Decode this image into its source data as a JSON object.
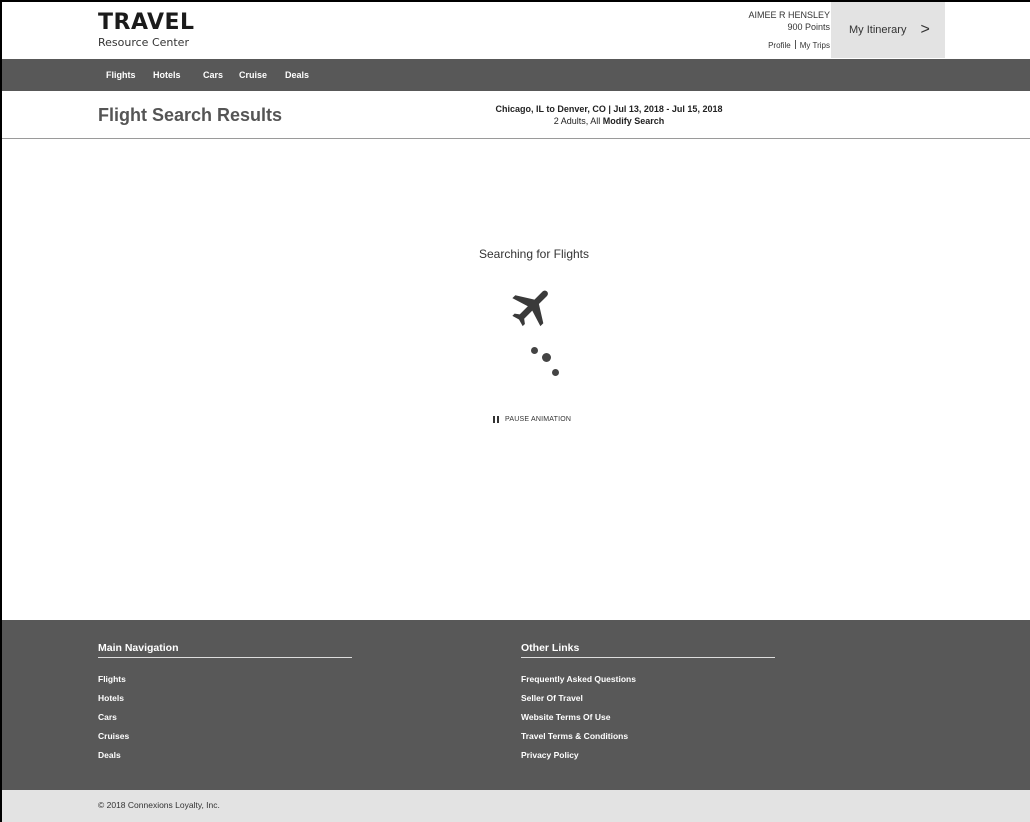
{
  "brand": {
    "name": "TRAVEL",
    "tagline": "Resource Center"
  },
  "user": {
    "name": "AIMEE R HENSLEY",
    "points": "900 Points",
    "profile_label": "Profile",
    "trips_label": "My Trips"
  },
  "itinerary": {
    "label": "My Itinerary",
    "chevron": ">"
  },
  "nav": {
    "items": [
      "Flights",
      "Hotels",
      "Cars",
      "Cruise",
      "Deals"
    ]
  },
  "page": {
    "title": "Flight Search Results",
    "route": "Chicago, IL to Denver, CO | Jul 13, 2018 - Jul 15, 2018",
    "travelers": "2 Adults, All",
    "modify_label": "Modify Search"
  },
  "loading": {
    "message": "Searching for Flights",
    "pause_label": "PAUSE ANIMATION",
    "icon": "airplane-icon"
  },
  "footer": {
    "main_nav": {
      "heading": "Main Navigation",
      "links": [
        "Flights",
        "Hotels",
        "Cars",
        "Cruises",
        "Deals"
      ]
    },
    "other_links": {
      "heading": "Other Links",
      "links": [
        "Frequently Asked Questions",
        "Seller Of Travel",
        "Website Terms Of Use",
        "Travel Terms & Conditions",
        "Privacy Policy"
      ]
    },
    "copyright": "© 2018 Connexions Loyalty, Inc."
  },
  "colors": {
    "nav_bg": "#585858",
    "footer_bg": "#585858",
    "itinerary_bg": "#e3e3e3",
    "copyright_bg": "#e3e3e3"
  }
}
